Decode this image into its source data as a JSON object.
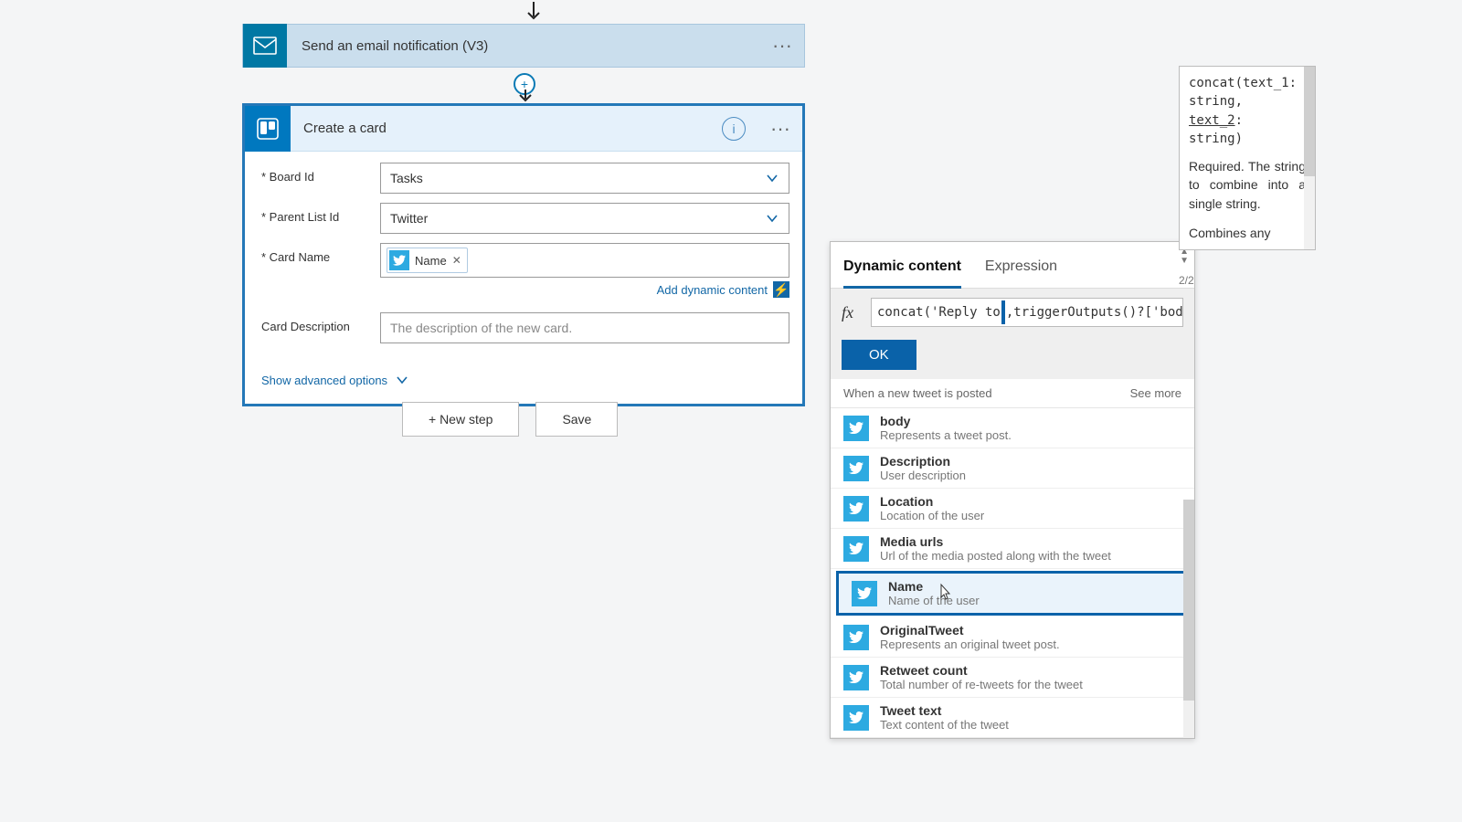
{
  "email_step": {
    "title": "Send an email notification (V3)"
  },
  "card_step": {
    "title": "Create a card",
    "fields": {
      "board_id": {
        "label": "Board Id",
        "value": "Tasks"
      },
      "parent_list_id": {
        "label": "Parent List Id",
        "value": "Twitter"
      },
      "card_name": {
        "label": "Card Name",
        "token_label": "Name"
      },
      "card_description": {
        "label": "Card Description",
        "placeholder": "The description of the new card."
      }
    },
    "add_dynamic": "Add dynamic content",
    "show_advanced": "Show advanced options"
  },
  "buttons": {
    "new_step": "+ New step",
    "save": "Save"
  },
  "dynamic_content": {
    "tabs": {
      "dynamic": "Dynamic content",
      "expression": "Expression"
    },
    "fx_prefix": "concat('Reply to ",
    "fx_suffix": ",triggerOutputs()?['bod",
    "ok": "OK",
    "section_title": "When a new tweet is posted",
    "see_more": "See more",
    "items": [
      {
        "title": "body",
        "desc": "Represents a tweet post."
      },
      {
        "title": "Description",
        "desc": "User description"
      },
      {
        "title": "Location",
        "desc": "Location of the user"
      },
      {
        "title": "Media urls",
        "desc": "Url of the media posted along with the tweet"
      },
      {
        "title": "Name",
        "desc": "Name of the user",
        "highlight": true
      },
      {
        "title": "OriginalTweet",
        "desc": "Represents an original tweet post."
      },
      {
        "title": "Retweet count",
        "desc": "Total number of re-tweets for the tweet"
      },
      {
        "title": "Tweet text",
        "desc": "Text content of the tweet"
      }
    ]
  },
  "tooltip": {
    "sig_line1": "concat(text_1:",
    "sig_line2": "string,",
    "sig_line3_a": "text_2",
    "sig_line3_b": ":",
    "sig_line4": "string)",
    "desc1": "Required. The string to combine into a single string.",
    "desc2": "Combines any",
    "page": "2/2"
  }
}
